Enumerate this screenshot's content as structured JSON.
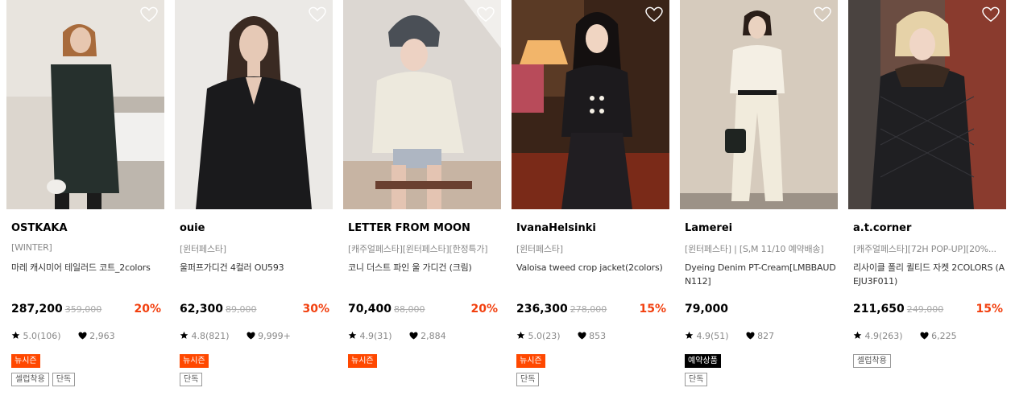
{
  "colors": {
    "discount": "#f2400f",
    "new_season": "#ff4800",
    "preorder": "#000000"
  },
  "products": [
    {
      "brand": "OSTKAKA",
      "tag": "[WINTER]",
      "title": "마레 캐시미어 테일러드 코트_2colors",
      "price": "287,200",
      "original_price": "359,000",
      "discount": "20%",
      "rating": "5.0(106)",
      "likes": "2,963",
      "badges_primary": [
        "뉴시즌"
      ],
      "badges_secondary": [
        "셀럽착용",
        "단독"
      ],
      "icon": "heart-outline-icon"
    },
    {
      "brand": "ouie",
      "tag": "[윈터페스타]",
      "title": "울퍼프가디건 4컬러 OU593",
      "price": "62,300",
      "original_price": "89,000",
      "discount": "30%",
      "rating": "4.8(821)",
      "likes": "9,999+",
      "badges_primary": [
        "뉴시즌"
      ],
      "badges_secondary": [
        "단독"
      ],
      "icon": "heart-outline-icon"
    },
    {
      "brand": "LETTER FROM MOON",
      "tag": "[캐주얼페스타][윈터페스타][한정특가]",
      "title": "코니 더스트 파인 울 가디건 (크림)",
      "price": "70,400",
      "original_price": "88,000",
      "discount": "20%",
      "rating": "4.9(31)",
      "likes": "2,884",
      "badges_primary": [
        "뉴시즌"
      ],
      "badges_secondary": [],
      "icon": "heart-outline-icon"
    },
    {
      "brand": "IvanaHelsinki",
      "tag": "[윈터페스타]",
      "title": "Valoisa tweed crop jacket(2colors)",
      "price": "236,300",
      "original_price": "278,000",
      "discount": "15%",
      "rating": "5.0(23)",
      "likes": "853",
      "badges_primary": [
        "뉴시즌"
      ],
      "badges_secondary": [
        "단독"
      ],
      "icon": "heart-outline-icon"
    },
    {
      "brand": "Lamerei",
      "tag": "[윈터페스타] | [S,M 11/10 예약배송]",
      "title": "Dyeing Denim PT-Cream[LMBBAUDN112]",
      "price": "79,000",
      "original_price": "",
      "discount": "",
      "rating": "4.9(51)",
      "likes": "827",
      "badges_primary": [
        "예약상품"
      ],
      "badges_secondary": [
        "단독"
      ],
      "icon": "heart-outline-icon"
    },
    {
      "brand": "a.t.corner",
      "tag": "[캐주얼페스타][72H POP-UP][20%...",
      "title": "리사이클 폴리 퀼티드 자켓 2COLORS (AEJU3F011)",
      "price": "211,650",
      "original_price": "249,000",
      "discount": "15%",
      "rating": "4.9(263)",
      "likes": "6,225",
      "badges_primary": [
        "셀럽착용"
      ],
      "badges_secondary": [],
      "icon": "heart-outline-icon"
    }
  ]
}
